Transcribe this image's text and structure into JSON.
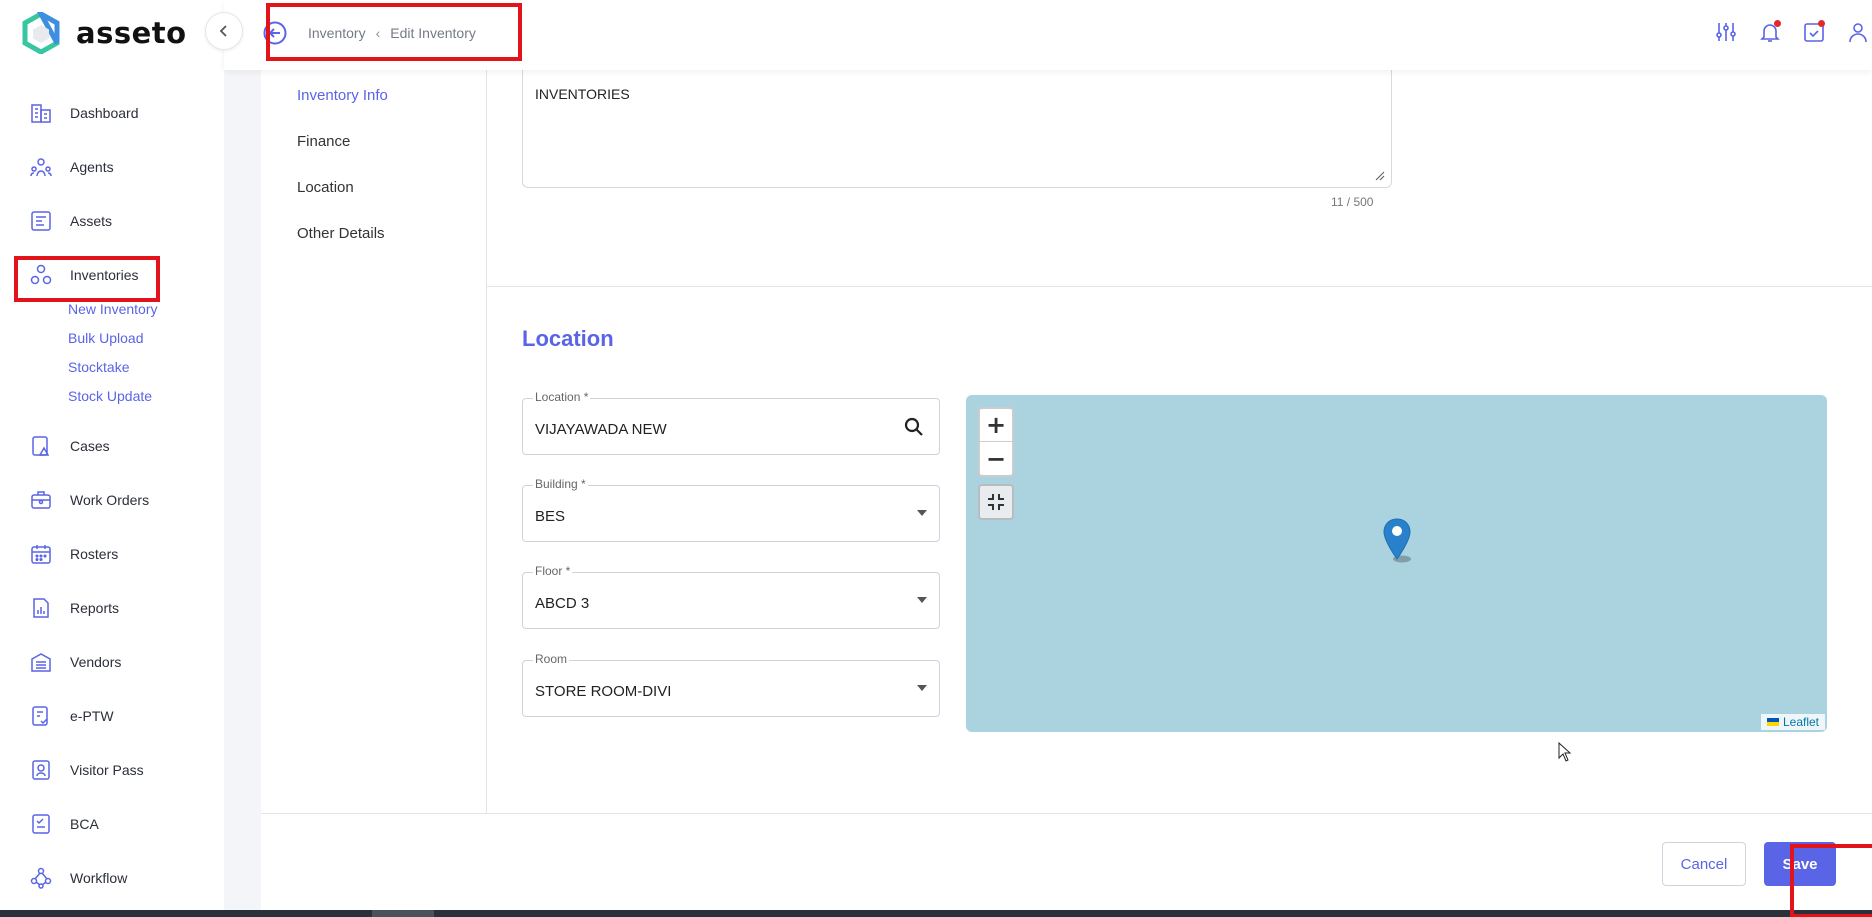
{
  "app": {
    "name": "asseto"
  },
  "breadcrumb": {
    "parent": "Inventory",
    "current": "Edit Inventory"
  },
  "sidebar": {
    "items": [
      {
        "label": "Dashboard",
        "icon": "dashboard-icon"
      },
      {
        "label": "Agents",
        "icon": "agents-icon"
      },
      {
        "label": "Assets",
        "icon": "assets-icon"
      },
      {
        "label": "Inventories",
        "icon": "inventories-icon"
      },
      {
        "label": "Cases",
        "icon": "cases-icon"
      },
      {
        "label": "Work Orders",
        "icon": "work-orders-icon"
      },
      {
        "label": "Rosters",
        "icon": "rosters-icon"
      },
      {
        "label": "Reports",
        "icon": "reports-icon"
      },
      {
        "label": "Vendors",
        "icon": "vendors-icon"
      },
      {
        "label": "e-PTW",
        "icon": "eptw-icon"
      },
      {
        "label": "Visitor Pass",
        "icon": "visitor-pass-icon"
      },
      {
        "label": "BCA",
        "icon": "bca-icon"
      },
      {
        "label": "Workflow",
        "icon": "workflow-icon"
      }
    ],
    "inventory_subitems": [
      "New Inventory",
      "Bulk Upload",
      "Stocktake",
      "Stock Update"
    ]
  },
  "section_nav": [
    "Inventory Info",
    "Finance",
    "Location",
    "Other Details"
  ],
  "description": {
    "value": "INVENTORIES",
    "counter": "11 / 500"
  },
  "location_section": {
    "title": "Location",
    "fields": [
      {
        "label": "Location *",
        "value": "VIJAYAWADA NEW"
      },
      {
        "label": "Building *",
        "value": "BES"
      },
      {
        "label": "Floor *",
        "value": "ABCD 3"
      },
      {
        "label": "Room",
        "value": "STORE ROOM-DIVI"
      }
    ]
  },
  "map": {
    "zoom_in": "+",
    "zoom_out": "−",
    "attribution": "Leaflet"
  },
  "footer": {
    "cancel": "Cancel",
    "save": "Save"
  },
  "colors": {
    "accent": "#5a64e6",
    "highlight": "#e3131c",
    "map_water": "#aad3df"
  }
}
